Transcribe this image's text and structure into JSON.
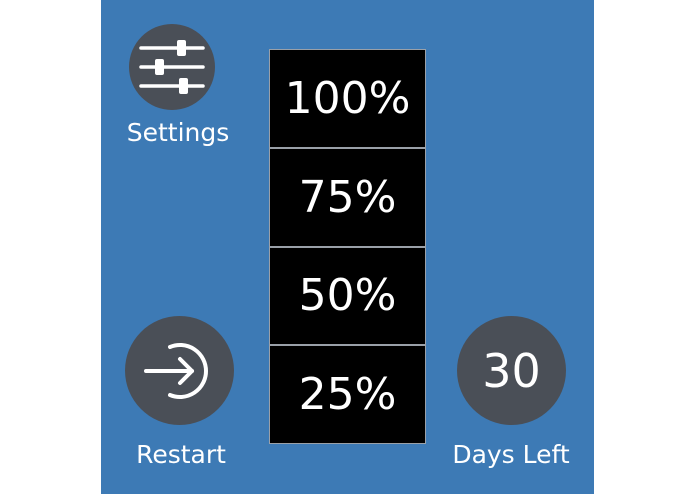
{
  "theme": {
    "panel_background": "#3d7ab5",
    "button_background": "#4a4f57",
    "text_color": "#ffffff",
    "level_background": "#000000",
    "divider_color": "#9aa0a8"
  },
  "settings": {
    "icon": "sliders-icon",
    "label": "Settings"
  },
  "levels": [
    {
      "label": "100%"
    },
    {
      "label": "75%"
    },
    {
      "label": "50%"
    },
    {
      "label": "25%"
    }
  ],
  "restart": {
    "icon": "enter-arrow-circle-icon",
    "label": "Restart"
  },
  "days_left": {
    "value": "30",
    "label": "Days Left"
  }
}
